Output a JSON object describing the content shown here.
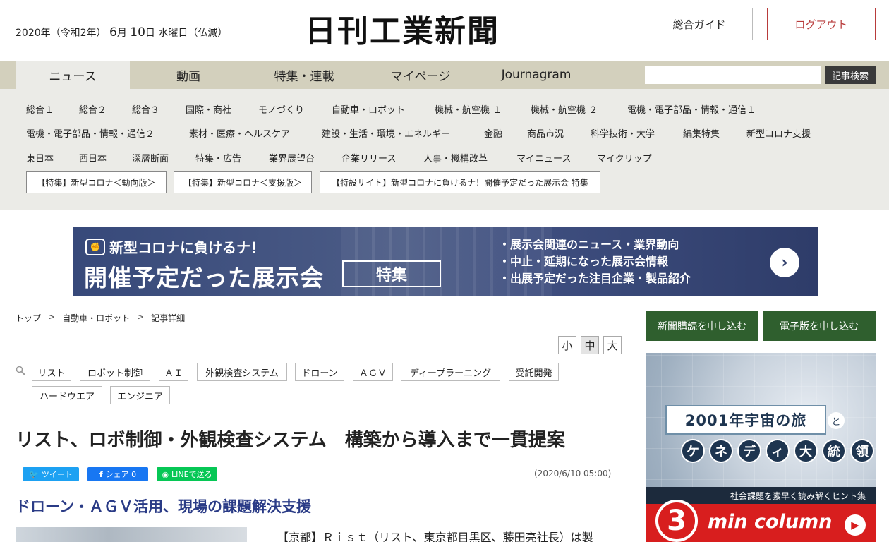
{
  "header": {
    "date_year": "2020年（令和2年）",
    "date_month": "6",
    "date_month_unit": "月",
    "date_day": "10",
    "date_day_unit": "日",
    "date_weekday": "水曜日（仏滅）",
    "logo": "日刊工業新聞",
    "guide_label": "総合ガイド",
    "logout_label": "ログアウト"
  },
  "nav": {
    "tabs": [
      "ニュース",
      "動画",
      "特集・連載",
      "マイページ",
      "Journagram"
    ],
    "active_tab": "ニュース",
    "search_placeholder": "",
    "search_button": "記事検索"
  },
  "subnav": {
    "rows": [
      [
        "総合１",
        "総合２",
        "総合３",
        "国際・商社",
        "モノづくり",
        "自動車・ロボット",
        "機械・航空機 １",
        "機械・航空機 ２",
        "電機・電子部品・情報・通信１"
      ],
      [
        "電機・電子部品・情報・通信２",
        "素材・医療・ヘルスケア",
        "建設・生活・環境・エネルギー",
        "金融",
        "商品市況",
        "科学技術・大学",
        "編集特集",
        "新型コロナ支援"
      ],
      [
        "東日本",
        "西日本",
        "深層断面",
        "特集・広告",
        "業界展望台",
        "企業リリース",
        "人事・機構改革",
        "マイニュース",
        "マイクリップ"
      ]
    ],
    "specials": [
      "【特集】新型コロナ＜動向版＞",
      "【特集】新型コロナ＜支援版＞",
      "【特設サイト】新型コロナに負けるナ！開催予定だった展示会 特集"
    ]
  },
  "banner": {
    "line1": "新型コロナに負けるナ！",
    "line2": "開催予定だった展示会",
    "tag": "特集",
    "bullets": [
      "・展示会関連のニュース・業界動向",
      "・中止・延期になった展示会情報",
      "・出展予定だった注目企業・製品紹介"
    ],
    "go": "›"
  },
  "breadcrumb": {
    "items": [
      "トップ",
      "自動車・ロボット",
      "記事詳細"
    ],
    "sep": ">"
  },
  "subscribe": {
    "paper": "新聞購読を申し込む",
    "digital": "電子版を申し込む"
  },
  "font_size": [
    "小",
    "中",
    "大"
  ],
  "font_size_active": "中",
  "tags": [
    "リスト",
    "ロボット制御",
    "ＡＩ",
    "外観検査システム",
    "ドローン",
    "ＡＧＶ",
    "ディープラーニング",
    "受託開発",
    "ハードウエア",
    "エンジニア"
  ],
  "article": {
    "title": "リスト、ロボ制御・外観検査システム　構築から導入まで一貫提案",
    "share_tweet": "ツイート",
    "share_fb": "シェア 0",
    "share_line": "LINEで送る",
    "timestamp": "(2020/6/10 05:00)",
    "subtitle": "ドローン・ＡＧＶ活用、現場の課題解決支援",
    "body_first_line": "【京都】Ｒｉｓｔ（リスト、東京都目黒区、藤田亮社長）は製"
  },
  "ad": {
    "title": "2001年宇宙の旅",
    "to": "と",
    "chars": [
      "ケ",
      "ネ",
      "デ",
      "ィ",
      "大",
      "統",
      "領"
    ],
    "hint": "社会課題を素早く読み解くヒント集",
    "three": "3",
    "min_column": "min column",
    "play": "▶"
  },
  "colors": {
    "nav_bg": "#d3d0bd",
    "subnav_bg": "#ebebe7",
    "logout": "#b83b3b",
    "subscribe": "#2f5f2e",
    "subtitle": "#2a3b86",
    "twitter": "#1da1f2",
    "facebook": "#1877f2",
    "line": "#06c755"
  }
}
